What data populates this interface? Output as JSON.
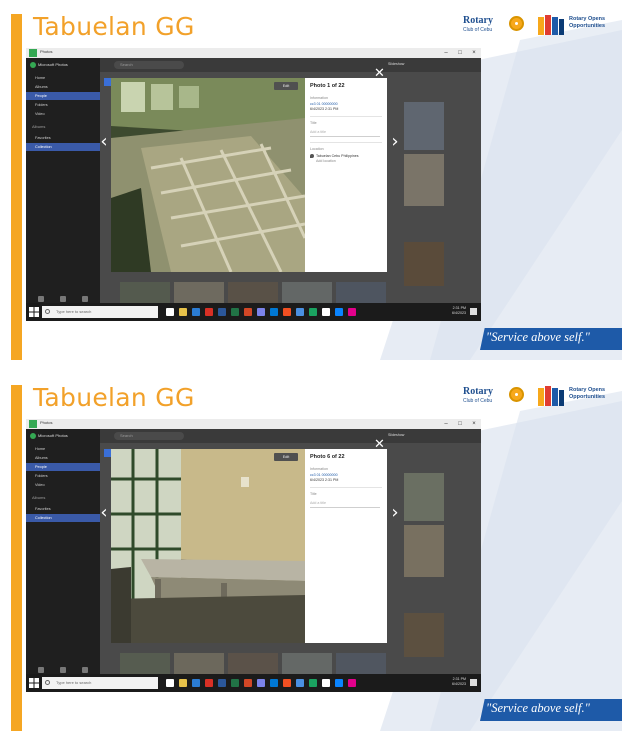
{
  "slides": [
    {
      "title": "Tabuelan GG",
      "motto": "\"Service above self.\"",
      "rotary_word": "Rotary",
      "rotary_sub": "Club of Cebu",
      "opps_line1": "Rotary Opens",
      "opps_line2": "Opportunities",
      "app": {
        "window_title": "Photos",
        "sidebar_header": "Microsoft Photos",
        "sidebar_items": [
          "Home",
          "Albums",
          "People",
          "Folders",
          "Video"
        ],
        "sidebar_section": "Albums",
        "sidebar_sub_items": [
          "Favorites",
          "Collection"
        ],
        "search_placeholder": "Search",
        "photo_edit_label": "Edit",
        "info_title": "Photo 1 of 22",
        "info_label_file": "Information",
        "info_file_line1": "cc3 01 00000000",
        "info_file_line2": "6/4/2023 2:31 PM",
        "info_label_title": "Title",
        "info_title_placeholder": "Add a title",
        "info_label_location": "Location",
        "info_location_line1": "Tabuelan Cebu Philippines",
        "info_location_line2": "Add location",
        "close_glyph": "✕",
        "prev_glyph": "‹",
        "next_glyph": "›",
        "right_mini_label": "Slideshow",
        "taskbar_search": "Type here to search",
        "tray_time": "2:31 PM",
        "tray_date": "6/4/2023"
      }
    },
    {
      "title": "Tabuelan GG",
      "motto": "\"Service above self.\"",
      "rotary_word": "Rotary",
      "rotary_sub": "Club of Cebu",
      "opps_line1": "Rotary Opens",
      "opps_line2": "Opportunities",
      "app": {
        "window_title": "Photos",
        "sidebar_header": "Microsoft Photos",
        "sidebar_items": [
          "Home",
          "Albums",
          "People",
          "Folders",
          "Video"
        ],
        "sidebar_section": "Albums",
        "sidebar_sub_items": [
          "Favorites",
          "Collection"
        ],
        "search_placeholder": "Search",
        "photo_edit_label": "Edit",
        "info_title": "Photo 6 of 22",
        "info_label_file": "Information",
        "info_file_line1": "cc3 01 00000000",
        "info_file_line2": "6/4/2023 2:31 PM",
        "info_label_title": "Title",
        "info_title_placeholder": "Add a title",
        "close_glyph": "✕",
        "prev_glyph": "‹",
        "next_glyph": "›",
        "right_mini_label": "Slideshow",
        "taskbar_search": "Type here to search",
        "tray_time": "2:31 PM",
        "tray_date": "6/4/2023"
      }
    }
  ],
  "colors": {
    "accent_orange": "#f5a623",
    "title_orange": "#f2a12a",
    "rotary_blue": "#1e5aa8",
    "sidebar_active": "#3a5aa8"
  }
}
